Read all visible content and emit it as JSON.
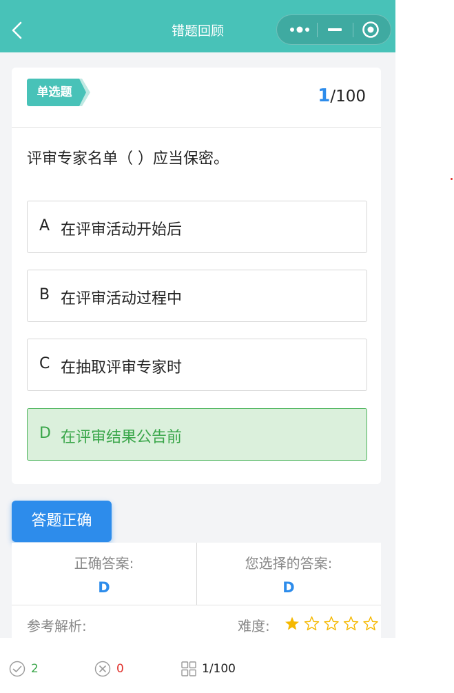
{
  "navbar": {
    "title": "错题回顾",
    "back_icon": "chevron-left-icon",
    "capsule_icons": [
      "more-dots-icon",
      "minimize-icon",
      "close-target-icon"
    ],
    "background": "#48c2b8"
  },
  "question": {
    "type_label": "单选题",
    "current": "1",
    "total": "/100",
    "text": "评审专家名单（ ）应当保密。",
    "options": [
      {
        "key": "A",
        "text": "在评审活动开始后",
        "state": "normal"
      },
      {
        "key": "B",
        "text": "在评审活动过程中",
        "state": "normal"
      },
      {
        "key": "C",
        "text": "在抽取评审专家时",
        "state": "normal"
      },
      {
        "key": "D",
        "text": "在评审结果公告前",
        "state": "correct"
      }
    ]
  },
  "result": {
    "badge": "答题正确",
    "correct_answer_label": "正确答案:",
    "correct_answer": "D",
    "selected_answer_label": "您选择的答案:",
    "selected_answer": "D",
    "analysis_label": "参考解析:",
    "difficulty_label": "难度:",
    "difficulty_stars": 1,
    "difficulty_max": 5
  },
  "bottom_bar": {
    "correct_count": "2",
    "wrong_count": "0",
    "progress": "1/100"
  },
  "colors": {
    "accent": "#48c2b8",
    "primary_blue": "#2d8ceb",
    "correct_green": "#3aa64a",
    "wrong_red": "#e0302b",
    "star_gold": "#f5b800"
  }
}
